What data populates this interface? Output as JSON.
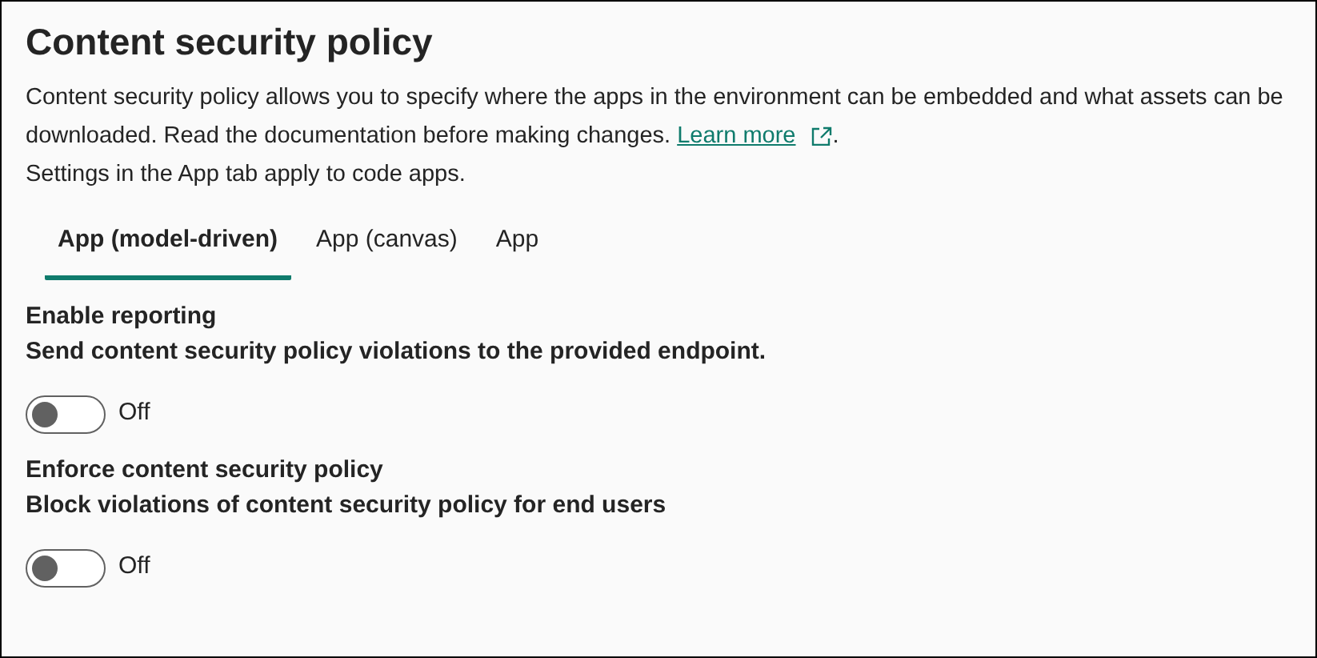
{
  "title": "Content security policy",
  "description": {
    "text": "Content security policy allows you to specify where the apps in the environment can be embedded and what assets can be downloaded. Read the documentation before making changes.",
    "link": "Learn more",
    "after": ".",
    "note": "Settings in the App tab apply to code apps."
  },
  "tabs": [
    {
      "label": "App (model-driven)",
      "selected": true
    },
    {
      "label": "App (canvas)",
      "selected": false
    },
    {
      "label": "App",
      "selected": false
    }
  ],
  "settings": [
    {
      "title": "Enable reporting",
      "description": "Send content security policy violations to the provided endpoint.",
      "on": false,
      "state_label": "Off"
    },
    {
      "title": "Enforce content security policy",
      "description": "Block violations of content security policy for end users",
      "on": false,
      "state_label": "Off"
    }
  ]
}
